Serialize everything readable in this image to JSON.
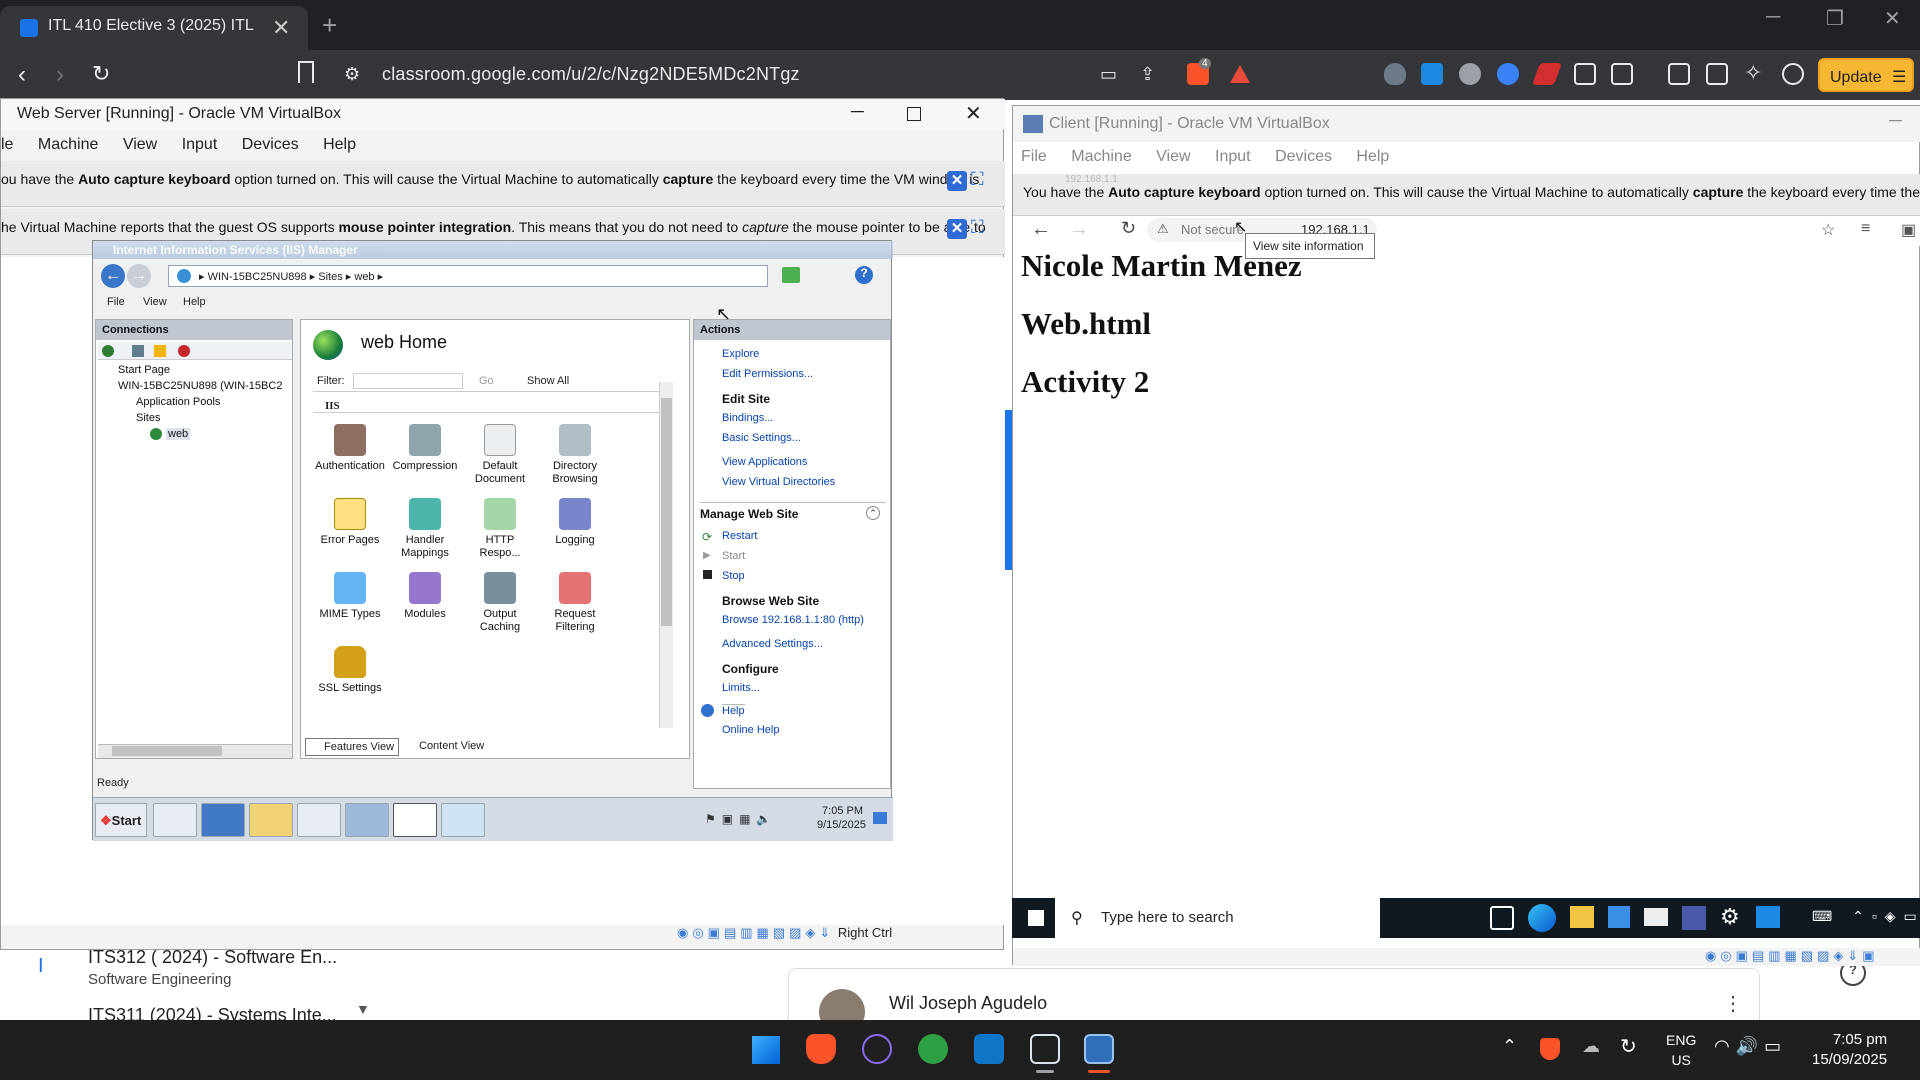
{
  "browser": {
    "tab_title": "ITL 410 Elective 3 (2025) ITL 410",
    "tab_close": "✕",
    "new_tab": "+",
    "url": "classroom.google.com/u/2/c/Nzg2NDE5MDc2NTgz",
    "update_label": "Update",
    "shield_badge": "4"
  },
  "web_server_vm": {
    "title": "Web Server [Running] - Oracle VM VirtualBox",
    "menu": [
      "le",
      "Machine",
      "View",
      "Input",
      "Devices",
      "Help"
    ],
    "notice1_pre": "ou have the ",
    "notice1_b1": "Auto capture keyboard",
    "notice1_mid": " option turned on. This will cause the Virtual Machine to automatically ",
    "notice1_b2": "capture",
    "notice1_post": " the keyboard every time the VM window is",
    "notice2_pre": "he Virtual Machine reports that the guest OS supports ",
    "notice2_b1": "mouse pointer integration",
    "notice2_mid": ". This means that you do not need to ",
    "notice2_i": "capture",
    "notice2_post": " the mouse pointer to be able to",
    "status_right_ctrl": "Right Ctrl"
  },
  "iis": {
    "window_title": "Internet Information Services (IIS) Manager",
    "breadcrumb": [
      "WIN-15BC25NU898",
      "Sites",
      "web"
    ],
    "menu": [
      "File",
      "View",
      "Help"
    ],
    "connections_title": "Connections",
    "tree": [
      "Start Page",
      "WIN-15BC25NU898 (WIN-15BC2",
      "Application Pools",
      "Sites",
      "web"
    ],
    "home_title": "web Home",
    "filter_label": "Filter:",
    "go_label": "Go",
    "show_all": "Show All",
    "group_label": "IIS",
    "features": [
      [
        "Authentication",
        "Compression",
        "Default\nDocument",
        "Directory\nBrowsing"
      ],
      [
        "Error Pages",
        "Handler\nMappings",
        "HTTP\nRespo...",
        "Logging"
      ],
      [
        "MIME Types",
        "Modules",
        "Output\nCaching",
        "Request\nFiltering"
      ],
      [
        "SSL Settings"
      ]
    ],
    "features_view": "Features View",
    "content_view": "Content View",
    "status": "Ready",
    "actions_title": "Actions",
    "actions": {
      "explore": "Explore",
      "edit_permissions": "Edit Permissions...",
      "edit_site": "Edit Site",
      "bindings": "Bindings...",
      "basic_settings": "Basic Settings...",
      "view_applications": "View Applications",
      "view_vdirs": "View Virtual Directories",
      "manage_web_site": "Manage Web Site",
      "restart": "Restart",
      "start": "Start",
      "stop": "Stop",
      "browse_web_site": "Browse Web Site",
      "browse_link": "Browse 192.168.1.1:80 (http)",
      "advanced_settings": "Advanced Settings...",
      "configure": "Configure",
      "limits": "Limits...",
      "help": "Help",
      "online_help": "Online Help"
    },
    "start_button": "Start",
    "clock_time": "7:05 PM",
    "clock_date": "9/15/2025"
  },
  "client_vm": {
    "title": "Client [Running] - Oracle VM VirtualBox",
    "menu": [
      "File",
      "Machine",
      "View",
      "Input",
      "Devices",
      "Help"
    ],
    "notice_pre": "You have the ",
    "notice_b1": "Auto capture keyboard",
    "notice_mid": " option turned on. This will cause the Virtual Machine to automatically ",
    "notice_b2": "capture",
    "notice_post": " the keyboard every time the VM windo",
    "ghost_tab": "192.168.1.1",
    "not_secure": "Not secure",
    "address": "192.168.1.1",
    "tooltip": "View site information",
    "heading1": "Nicole Martin Menez",
    "heading2": "Web.html",
    "heading3": "Activity 2",
    "search_placeholder": "Type here to search"
  },
  "classroom": {
    "class1_title": "ITS312 ( 2024) - Software En...",
    "class1_sub": "Software Engineering",
    "class1_letter": "I",
    "class2_title": "ITS311 (2024) - Systems Inte...",
    "teacher": "Wil Joseph Agudelo"
  },
  "taskbar": {
    "lang_top": "ENG",
    "lang_bottom": "US",
    "time": "7:05 pm",
    "date": "15/09/2025"
  },
  "colors": {
    "browser_dark": "#202124",
    "accent_blue": "#1a73e8",
    "update_orange": "#f7b733",
    "iis_link": "#0645ad"
  }
}
